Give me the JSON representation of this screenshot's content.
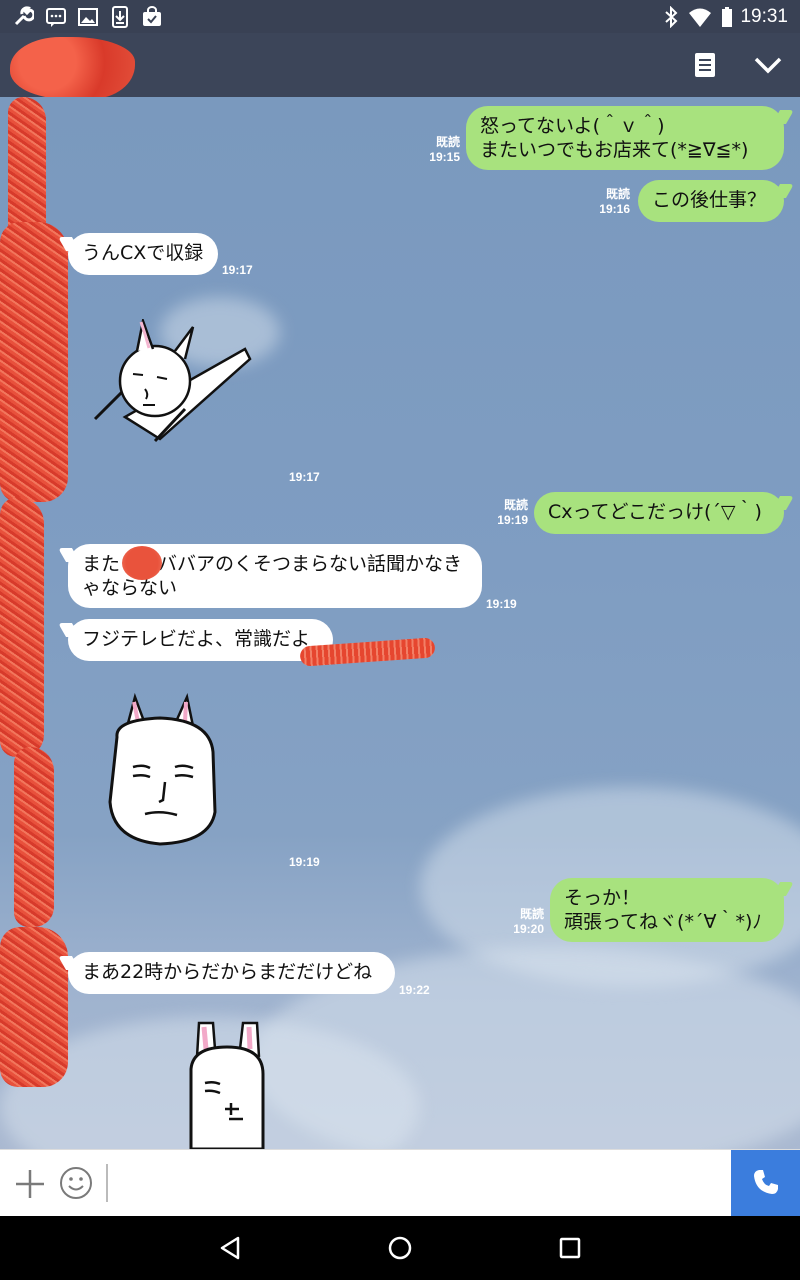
{
  "status_bar": {
    "time": "19:31",
    "left_icons": [
      "wrench-icon",
      "chat-notification-icon",
      "image-icon",
      "download-icon",
      "bag-icon"
    ],
    "right_icons": [
      "bluetooth-icon",
      "wifi-icon",
      "battery-icon"
    ]
  },
  "header": {
    "contact_name": "",
    "buttons": [
      "note-icon",
      "chevron-down-icon"
    ]
  },
  "messages": [
    {
      "dir": "out",
      "text": "怒ってないよ(＾ｖ＾)\nまたいつでもお店来て(*≧∇≦*)",
      "read": "既読",
      "time": "19:15"
    },
    {
      "dir": "out",
      "text": "この後仕事？",
      "read": "既読",
      "time": "19:16"
    },
    {
      "dir": "in",
      "text": "うんCXで収録",
      "time": "19:17"
    },
    {
      "dir": "in",
      "sticker": "rabbit-lying-sticker",
      "time": "19:17"
    },
    {
      "dir": "out",
      "text": "Cxってどこだっけ(´▽｀)",
      "read": "既読",
      "time": "19:19"
    },
    {
      "dir": "in",
      "text": "また　バババアのくそつまらない話聞かなきゃならない",
      "time": "19:19"
    },
    {
      "dir": "in",
      "text": "フジテレビだよ、常識だよ",
      "time": ""
    },
    {
      "dir": "in",
      "sticker": "rabbit-face-sticker",
      "time": "19:19"
    },
    {
      "dir": "out",
      "text": "そっか！\n頑張ってねヾ(*´∀｀*)ﾉ",
      "read": "既読",
      "time": "19:20"
    },
    {
      "dir": "in",
      "text": "まあ22時からだからまだだけどね",
      "time": "19:22"
    },
    {
      "dir": "in",
      "sticker": "rabbit-peek-sticker",
      "time": ""
    }
  ],
  "input": {
    "placeholder": "",
    "value": ""
  },
  "nav": [
    "back-icon",
    "home-icon",
    "recents-icon"
  ],
  "colors": {
    "header": "#3c4559",
    "outgoing_bubble": "#a8e27e",
    "incoming_bubble": "#ffffff",
    "call_button": "#3b7ddd"
  }
}
